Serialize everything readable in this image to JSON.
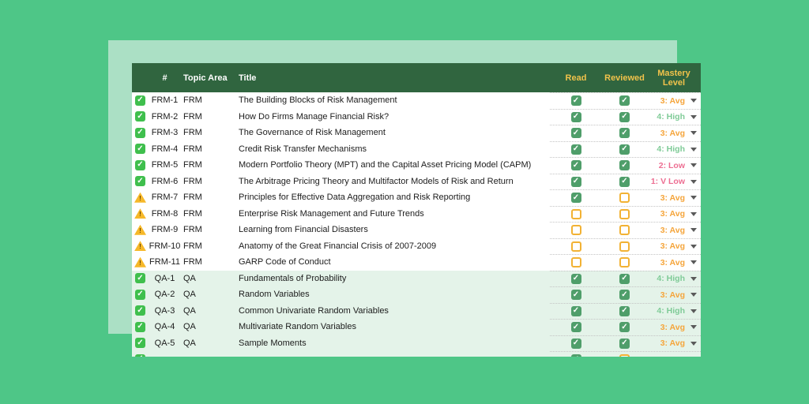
{
  "colors": {
    "bg": "#4EC687",
    "panel": "#ABE0C5",
    "header_bg": "#30653F",
    "header_gold": "#F0C24B",
    "row_alt_bg": "#E4F3E9",
    "check_green": "#4F9E6A",
    "box_amber": "#F2B234",
    "status_green": "#3FBF4D",
    "warn_amber": "#F6B829",
    "mastery_high": "#7FCB97",
    "mastery_avg": "#F5A53B",
    "mastery_low": "#ED6E92",
    "dotted_line": "#C4C4C4",
    "text_dark": "#1C1C1C"
  },
  "table": {
    "header": {
      "num": "#",
      "topic": "Topic Area",
      "title": "Title",
      "read": "Read",
      "reviewed": "Reviewed",
      "mastery": "Mastery Level"
    },
    "status_icons": {
      "done": "status-check-icon",
      "warning": "status-warning-icon"
    },
    "rows": [
      {
        "id": "FRM-1",
        "topic": "FRM",
        "title": "The Building Blocks of Risk Management",
        "status": "done",
        "read": true,
        "reviewed": true,
        "mastery": "3: Avg",
        "level": "avg",
        "section": "frm"
      },
      {
        "id": "FRM-2",
        "topic": "FRM",
        "title": "How Do Firms Manage Financial Risk?",
        "status": "done",
        "read": true,
        "reviewed": true,
        "mastery": "4: High",
        "level": "high",
        "section": "frm"
      },
      {
        "id": "FRM-3",
        "topic": "FRM",
        "title": "The Governance of Risk Management",
        "status": "done",
        "read": true,
        "reviewed": true,
        "mastery": "3: Avg",
        "level": "avg",
        "section": "frm"
      },
      {
        "id": "FRM-4",
        "topic": "FRM",
        "title": "Credit Risk Transfer Mechanisms",
        "status": "done",
        "read": true,
        "reviewed": true,
        "mastery": "4: High",
        "level": "high",
        "section": "frm"
      },
      {
        "id": "FRM-5",
        "topic": "FRM",
        "title": "Modern Portfolio Theory (MPT) and the Capital Asset Pricing Model (CAPM)",
        "status": "done",
        "read": true,
        "reviewed": true,
        "mastery": "2: Low",
        "level": "low",
        "section": "frm"
      },
      {
        "id": "FRM-6",
        "topic": "FRM",
        "title": "The Arbitrage Pricing Theory and Multifactor Models of Risk and Return",
        "status": "done",
        "read": true,
        "reviewed": true,
        "mastery": "1: V Low",
        "level": "low",
        "section": "frm"
      },
      {
        "id": "FRM-7",
        "topic": "FRM",
        "title": "Principles for Effective Data Aggregation and Risk Reporting",
        "status": "warning",
        "read": true,
        "reviewed": false,
        "mastery": "3: Avg",
        "level": "avg",
        "section": "frm"
      },
      {
        "id": "FRM-8",
        "topic": "FRM",
        "title": "Enterprise Risk Management and Future Trends",
        "status": "warning",
        "read": false,
        "reviewed": false,
        "mastery": "3: Avg",
        "level": "avg",
        "section": "frm"
      },
      {
        "id": "FRM-9",
        "topic": "FRM",
        "title": "Learning from Financial Disasters",
        "status": "warning",
        "read": false,
        "reviewed": false,
        "mastery": "3: Avg",
        "level": "avg",
        "section": "frm"
      },
      {
        "id": "FRM-10",
        "topic": "FRM",
        "title": "Anatomy of the Great Financial Crisis of 2007-2009",
        "status": "warning",
        "read": false,
        "reviewed": false,
        "mastery": "3: Avg",
        "level": "avg",
        "section": "frm"
      },
      {
        "id": "FRM-11",
        "topic": "FRM",
        "title": "GARP Code of Conduct",
        "status": "warning",
        "read": false,
        "reviewed": false,
        "mastery": "3: Avg",
        "level": "avg",
        "section": "frm"
      },
      {
        "id": "QA-1",
        "topic": "QA",
        "title": "Fundamentals of Probability",
        "status": "done",
        "read": true,
        "reviewed": true,
        "mastery": "4: High",
        "level": "high",
        "section": "qa"
      },
      {
        "id": "QA-2",
        "topic": "QA",
        "title": "Random Variables",
        "status": "done",
        "read": true,
        "reviewed": true,
        "mastery": "3: Avg",
        "level": "avg",
        "section": "qa"
      },
      {
        "id": "QA-3",
        "topic": "QA",
        "title": "Common Univariate Random Variables",
        "status": "done",
        "read": true,
        "reviewed": true,
        "mastery": "4: High",
        "level": "high",
        "section": "qa"
      },
      {
        "id": "QA-4",
        "topic": "QA",
        "title": "Multivariate Random Variables",
        "status": "done",
        "read": true,
        "reviewed": true,
        "mastery": "3: Avg",
        "level": "avg",
        "section": "qa"
      },
      {
        "id": "QA-5",
        "topic": "QA",
        "title": "Sample Moments",
        "status": "done",
        "read": true,
        "reviewed": true,
        "mastery": "3: Avg",
        "level": "avg",
        "section": "qa"
      }
    ],
    "partial_row": {
      "id": "",
      "topic": "",
      "title": "",
      "status": "done",
      "read": true,
      "reviewed": false,
      "mastery": "",
      "level": "avg",
      "section": "qa"
    }
  }
}
